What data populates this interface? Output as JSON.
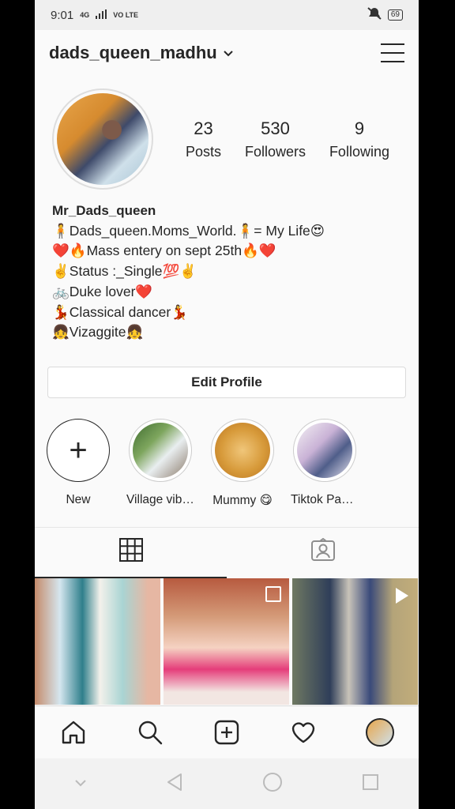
{
  "status_bar": {
    "time": "9:01",
    "network_small": "4G",
    "lte": "VO LTE",
    "battery": "69"
  },
  "header": {
    "username": "dads_queen_madhu"
  },
  "stats": [
    {
      "value": "23",
      "label": "Posts"
    },
    {
      "value": "530",
      "label": "Followers"
    },
    {
      "value": "9",
      "label": "Following"
    }
  ],
  "bio": {
    "name": "Mr_Dads_queen",
    "lines": [
      "🧍Dads_queen.Moms_World.🧍= My Life😍",
      "❤️🔥Mass entery on sept 25th🔥❤️",
      "✌️Status :_Single💯✌️",
      "🚲Duke lover❤️",
      "💃Classical dancer💃",
      "👧Vizaggite👧"
    ]
  },
  "edit_profile_label": "Edit Profile",
  "highlights": [
    {
      "label": "New"
    },
    {
      "label": "Village vibes..."
    },
    {
      "label": "Mummy 😋"
    },
    {
      "label": "Tiktok Passi..."
    }
  ],
  "colors": {
    "text": "#262626",
    "border": "#dbdbdb",
    "background": "#fafafa"
  }
}
